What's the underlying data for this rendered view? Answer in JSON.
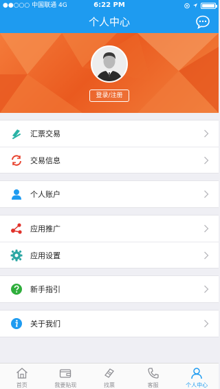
{
  "status_bar": {
    "carrier": "●●○○○ 中国联通  4G",
    "time": "6:22 PM"
  },
  "header": {
    "title": "个人中心",
    "message_icon": "chat-bubble-icon"
  },
  "profile": {
    "login_label": "登录/注册",
    "avatar_icon": "user-avatar-icon"
  },
  "menu": {
    "groups": [
      {
        "items": [
          {
            "label": "汇票交易",
            "icon": "bill-trade-icon",
            "color": "#2ab3a6"
          },
          {
            "label": "交易信息",
            "icon": "refresh-cycle-icon",
            "color": "#e8432e"
          }
        ]
      },
      {
        "items": [
          {
            "label": "个人账户",
            "icon": "person-icon",
            "color": "#1e9bf0"
          }
        ]
      },
      {
        "items": [
          {
            "label": "应用推广",
            "icon": "share-icon",
            "color": "#e0322b"
          },
          {
            "label": "应用设置",
            "icon": "gear-icon",
            "color": "#2aa6a3"
          }
        ]
      },
      {
        "items": [
          {
            "label": "新手指引",
            "icon": "question-icon",
            "color": "#2fae3c"
          }
        ]
      },
      {
        "items": [
          {
            "label": "关于我们",
            "icon": "info-icon",
            "color": "#1e9bf0"
          }
        ]
      }
    ]
  },
  "tabbar": {
    "items": [
      {
        "label": "首页",
        "icon": "home-icon"
      },
      {
        "label": "我要贴现",
        "icon": "wallet-icon"
      },
      {
        "label": "找票",
        "icon": "ticket-icon"
      },
      {
        "label": "客服",
        "icon": "phone-icon"
      },
      {
        "label": "个人中心",
        "icon": "user-icon"
      }
    ],
    "active_index": 4
  },
  "colors": {
    "primary": "#1e9bf0",
    "hero": "#ef6a2a",
    "background": "#efeff4"
  }
}
